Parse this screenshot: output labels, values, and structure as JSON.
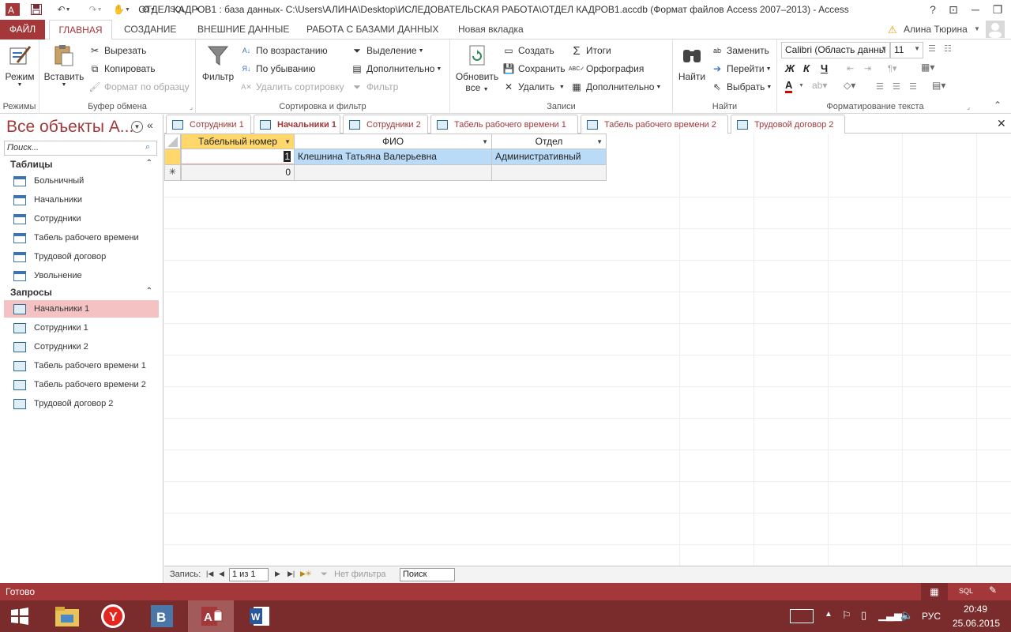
{
  "window": {
    "title": "ОТДЕЛ КАДРОВ1 : база данных- C:\\Users\\АЛИНА\\Desktop\\ИСЛЕДОВАТЕЛЬСКАЯ РАБОТА\\ОТДЕЛ КАДРОВ1.accdb (Формат файлов Access 2007–2013) - Access",
    "quick_access_sql": "SQL",
    "help": "?"
  },
  "ribbon_tabs": [
    {
      "label": "ФАЙЛ"
    },
    {
      "label": "ГЛАВНАЯ"
    },
    {
      "label": "СОЗДАНИЕ"
    },
    {
      "label": "ВНЕШНИЕ ДАННЫЕ"
    },
    {
      "label": "РАБОТА С БАЗАМИ ДАННЫХ"
    },
    {
      "label": "Новая вкладка"
    }
  ],
  "user": {
    "name": "Алина Тюрина"
  },
  "ribbon": {
    "modes": {
      "view_label": "Режим",
      "group_label": "Режимы"
    },
    "clipboard": {
      "paste": "Вставить",
      "cut": "Вырезать",
      "copy": "Копировать",
      "format_painter": "Формат по образцу",
      "group_label": "Буфер обмена"
    },
    "sort_filter": {
      "filter": "Фильтр",
      "ascending": "По возрастанию",
      "descending": "По убыванию",
      "remove_sort": "Удалить сортировку",
      "selection": "Выделение",
      "advanced": "Дополнительно",
      "toggle_filter": "Фильтр",
      "group_label": "Сортировка и фильтр"
    },
    "records": {
      "refresh_line1": "Обновить",
      "refresh_line2": "все",
      "new": "Создать",
      "save": "Сохранить",
      "delete": "Удалить",
      "totals": "Итоги",
      "spelling": "Орфография",
      "more": "Дополнительно",
      "group_label": "Записи"
    },
    "find": {
      "find": "Найти",
      "replace": "Заменить",
      "goto": "Перейти",
      "select": "Выбрать",
      "group_label": "Найти"
    },
    "text_format": {
      "font": "Calibri (Область данны",
      "size": "11",
      "bold": "Ж",
      "italic": "К",
      "underline": "Ч",
      "group_label": "Форматирование текста"
    }
  },
  "nav_pane": {
    "title": "Все объекты A...",
    "search_placeholder": "Поиск...",
    "sections": [
      {
        "label": "Таблицы",
        "items": [
          "Больничный",
          "Начальники",
          "Сотрудники",
          "Табель рабочего времени",
          "Трудовой договор",
          "Увольнение"
        ]
      },
      {
        "label": "Запросы",
        "items": [
          "Начальники 1",
          "Сотрудники 1",
          "Сотрудники 2",
          "Табель рабочего времени 1",
          "Табель рабочего времени 2",
          "Трудовой договор 2"
        ]
      }
    ],
    "selected_item": "Начальники 1"
  },
  "doc_tabs": [
    {
      "label": "Сотрудники 1"
    },
    {
      "label": "Начальники 1"
    },
    {
      "label": "Сотрудники 2"
    },
    {
      "label": "Табель рабочего времени 1"
    },
    {
      "label": "Табель рабочего времени 2"
    },
    {
      "label": "Трудовой договор 2"
    }
  ],
  "active_doc_tab": "Начальники 1",
  "datasheet": {
    "columns": [
      "Табельный номер",
      "ФИО",
      "Отдел"
    ],
    "rows": [
      {
        "Табельный номер": "1",
        "ФИО": "Клешнина Татьяна Валерьевна",
        "Отдел": "Административный"
      }
    ],
    "new_row_value": "0"
  },
  "record_nav": {
    "label": "Запись:",
    "position": "1 из 1",
    "filter": "Нет фильтра",
    "search": "Поиск"
  },
  "statusbar": {
    "text": "Готово",
    "sql": "SQL"
  },
  "taskbar": {
    "lang": "РУС",
    "time": "20:49",
    "date": "25.06.2015"
  },
  "colors": {
    "access_red": "#a4373a",
    "selection_pink": "#f5c2c3",
    "row_blue": "#b9dbf8",
    "header_yellow": "#ffd76b"
  }
}
